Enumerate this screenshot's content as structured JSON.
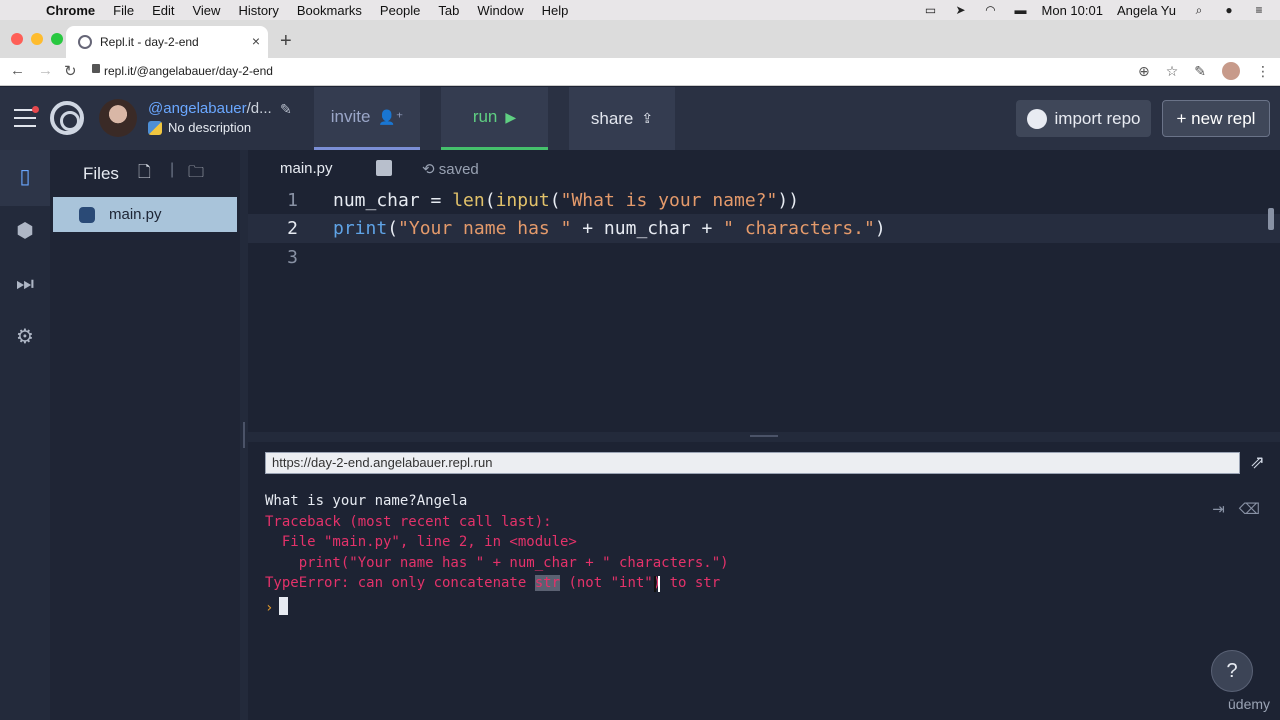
{
  "menubar": {
    "apple": "",
    "items": [
      "Chrome",
      "File",
      "Edit",
      "View",
      "History",
      "Bookmarks",
      "People",
      "Tab",
      "Window",
      "Help"
    ],
    "clock": "Mon 10:01",
    "user": "Angela Yu"
  },
  "browser": {
    "tab_title": "Repl.it - day-2-end",
    "tab_close": "×",
    "new_tab": "+",
    "url": "repl.it/@angelabauer/day-2-end"
  },
  "header": {
    "username": "@angelabauer",
    "repl_name_trunc": "/d...",
    "description": "No description",
    "invite_label": "invite",
    "invite_glyph": "👤⁺",
    "run_label": "run",
    "run_glyph": "▶",
    "share_label": "share",
    "share_glyph": "⇪",
    "import_label": "import repo",
    "new_label": "+ new repl"
  },
  "files": {
    "title": "Files",
    "items": [
      {
        "name": "main.py"
      }
    ]
  },
  "editor": {
    "tab_name": "main.py",
    "status": "saved",
    "lines": [
      {
        "n": "1"
      },
      {
        "n": "2"
      },
      {
        "n": "3"
      }
    ],
    "code": {
      "l1_a": "num_char = ",
      "l1_len": "len",
      "l1_b": "(",
      "l1_input": "input",
      "l1_c": "(",
      "l1_str": "\"What is your name?\"",
      "l1_d": "))",
      "l2_print": "print",
      "l2_a": "(",
      "l2_s1": "\"Your name has \"",
      "l2_b": " + num_char + ",
      "l2_s2": "\" characters.\"",
      "l2_c": ")"
    }
  },
  "console": {
    "url": "https://day-2-end.angelabauer.repl.run",
    "l1": "What is your name?Angela",
    "l2": "Traceback (most recent call last):",
    "l3": "  File \"main.py\", line 2, in <module>",
    "l4": "    print(\"Your name has \" + num_char + \" characters.\")",
    "l5_a": "TypeError: can only concatenate ",
    "l5_sel": "str",
    "l5_b": " (not \"int\") to str",
    "prompt": "›",
    "help": "?",
    "watermark": "ūdemy"
  },
  "colors": {
    "bg": "#1d2333",
    "header": "#2a3143",
    "error": "#e4326a",
    "run": "#5fcf82"
  }
}
